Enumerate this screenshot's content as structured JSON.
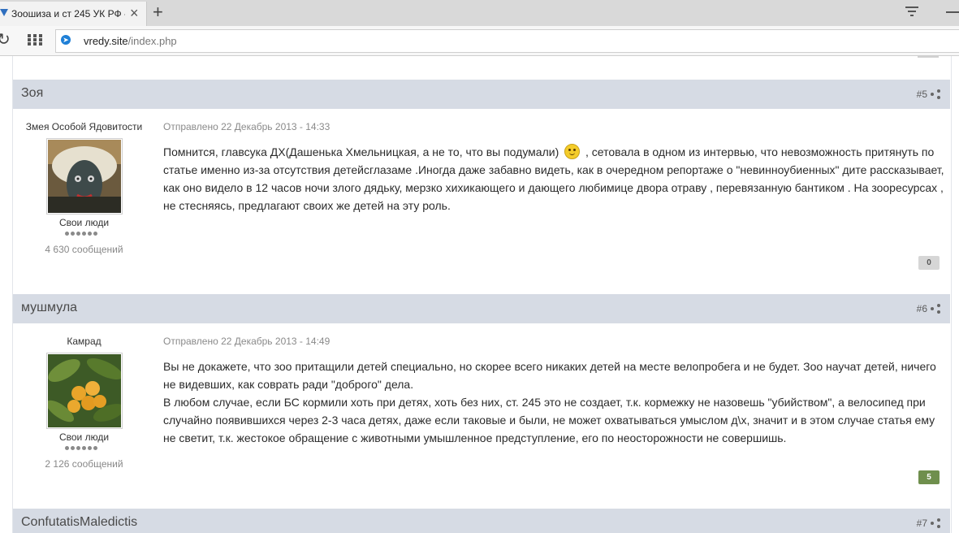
{
  "browser": {
    "tab_title": "Зоошиза и ст 245 УК РФ -",
    "tab_close": "×",
    "new_tab": "+",
    "reload": "↻",
    "address_host": "vredy.site",
    "address_path": "/index.php"
  },
  "posts": [
    {
      "author": "Зоя",
      "number": "#5",
      "user_title": "Змея Особой Ядовитости",
      "group": "Свои люди",
      "message_count": "4 630 сообщений",
      "posted": "Отправлено 22 Декабрь 2013 - 14:33",
      "text_part1": "Помнится,  главсука ДХ(Дашенька Хмельницкая, а не то, что вы подумали)",
      "text_part2": ", сетовала в одном из интервью, что невозможность притянуть по статье именно из-за отсутствия детейсглазаме .Иногда  даже забавно видеть, как в очередном репортаже о \"невинноубиенных\" дите рассказывает, как оно видело в 12 часов ночи злого дядьку, мерзко хихикающего и дающего любимице двора отраву , перевязанную бантиком . На зооресурсах , не стесняясь, предлагают своих же детей на эту роль.",
      "reputation": "0"
    },
    {
      "author": "мушмула",
      "number": "#6",
      "user_title": "Камрад",
      "group": "Свои люди",
      "message_count": "2 126 сообщений",
      "posted": "Отправлено 22 Декабрь 2013 - 14:49",
      "text_para1": "Вы не докажете, что зоо притащили детей специально, но скорее всего никаких детей на месте велопробега и не будет. Зоо научат детей, ничего не видевших, как соврать ради \"доброго\" дела.",
      "text_para2": "В любом случае, если БС кормили хоть при детях, хоть без них, ст. 245 это не создает, т.к. кормежку не назовешь \"убийством\", а велосипед при случайно появившихся через 2-3 часа детях, даже если таковые и были, не может охватываться умыслом д\\х, значит и в этом случае статья ему не светит, т.к. жестокое обращение с животными умышленное предступление, его по неосторожности не совершишь.",
      "reputation": "5"
    },
    {
      "author": "ConfutatisMaledictis",
      "number": "#7"
    }
  ],
  "colors": {
    "post_header_bg": "#d6dbe4",
    "rep_positive": "#6f8f4d",
    "rep_neutral": "#d6d6d6"
  }
}
